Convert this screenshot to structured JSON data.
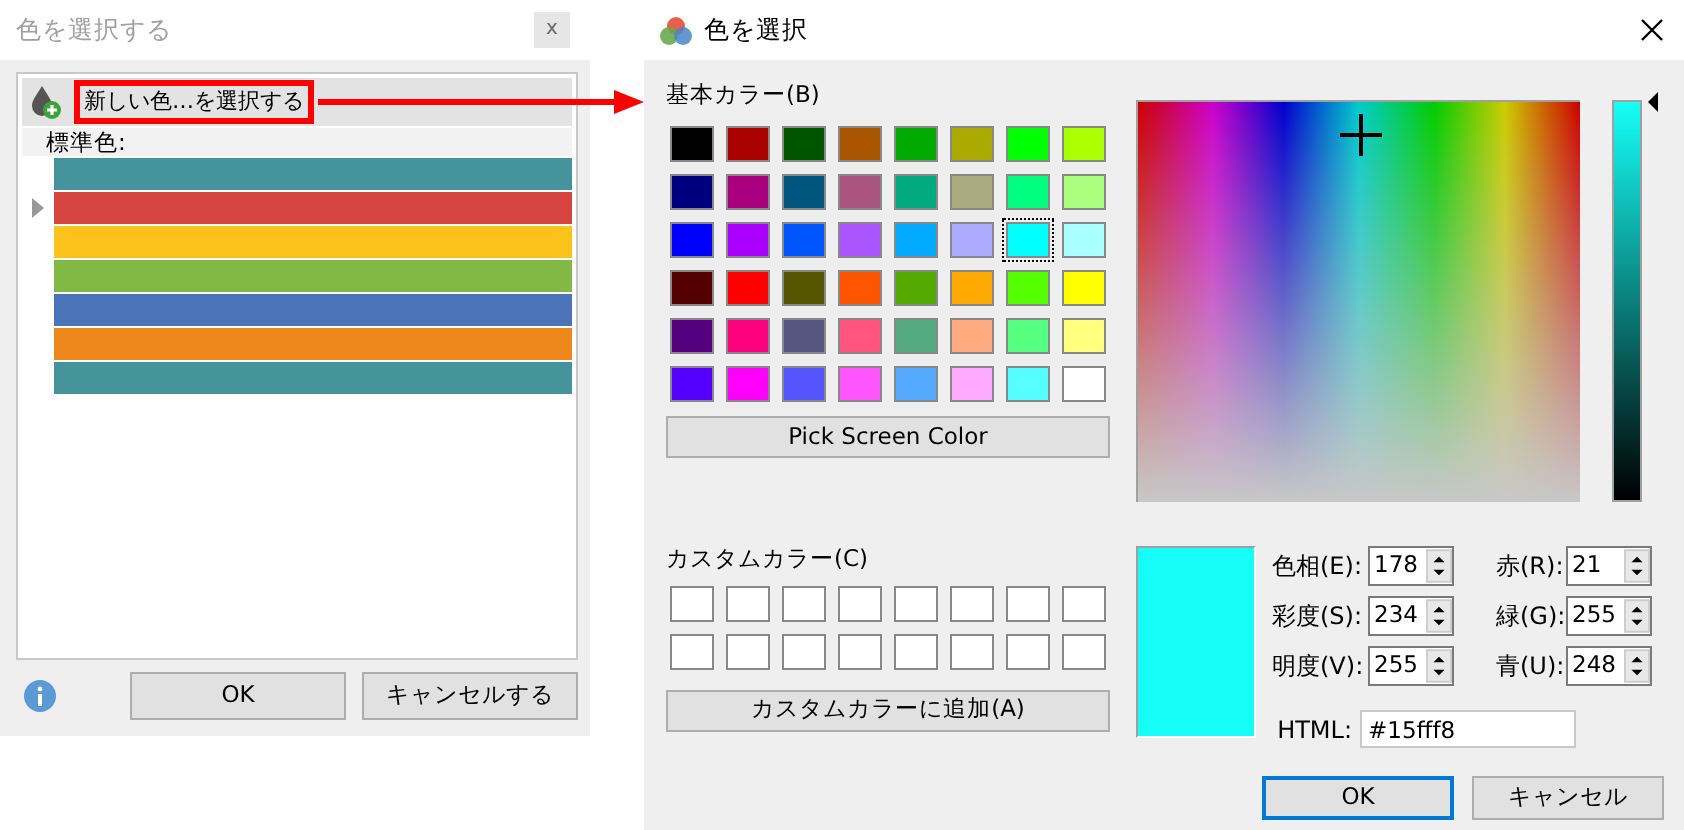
{
  "left_dialog": {
    "title": "色を選択する",
    "close": "x",
    "new_color_label": "新しい色…を選択する",
    "section_label": "標準色:",
    "standard_colors": [
      {
        "color": "#45939b",
        "selected": false
      },
      {
        "color": "#d5443f",
        "selected": true
      },
      {
        "color": "#fbc21c",
        "selected": false
      },
      {
        "color": "#82b844",
        "selected": false
      },
      {
        "color": "#4b74b8",
        "selected": false
      },
      {
        "color": "#ef881a",
        "selected": false
      },
      {
        "color": "#45939b",
        "selected": false
      }
    ],
    "buttons": [
      {
        "label": "OK"
      },
      {
        "label": "キャンセルする"
      }
    ]
  },
  "color_dialog": {
    "title": "色を選択",
    "basic_label": "基本カラー(B)",
    "basic_colors": [
      {
        "color": "#000000",
        "selected": false
      },
      {
        "color": "#aa0000",
        "selected": false
      },
      {
        "color": "#005500",
        "selected": false
      },
      {
        "color": "#aa5500",
        "selected": false
      },
      {
        "color": "#00aa00",
        "selected": false
      },
      {
        "color": "#aaaa00",
        "selected": false
      },
      {
        "color": "#00ff00",
        "selected": false
      },
      {
        "color": "#aaff00",
        "selected": false
      },
      {
        "color": "#00007f",
        "selected": false
      },
      {
        "color": "#aa007f",
        "selected": false
      },
      {
        "color": "#00557f",
        "selected": false
      },
      {
        "color": "#aa557f",
        "selected": false
      },
      {
        "color": "#00aa7f",
        "selected": false
      },
      {
        "color": "#aaaa7f",
        "selected": false
      },
      {
        "color": "#00ff7f",
        "selected": false
      },
      {
        "color": "#aaff7f",
        "selected": false
      },
      {
        "color": "#0000ff",
        "selected": false
      },
      {
        "color": "#aa00ff",
        "selected": false
      },
      {
        "color": "#0055ff",
        "selected": false
      },
      {
        "color": "#aa55ff",
        "selected": false
      },
      {
        "color": "#00aaff",
        "selected": false
      },
      {
        "color": "#aaaaff",
        "selected": false
      },
      {
        "color": "#00ffff",
        "selected": true
      },
      {
        "color": "#aaffff",
        "selected": false
      },
      {
        "color": "#550000",
        "selected": false
      },
      {
        "color": "#ff0000",
        "selected": false
      },
      {
        "color": "#555500",
        "selected": false
      },
      {
        "color": "#ff5500",
        "selected": false
      },
      {
        "color": "#55aa00",
        "selected": false
      },
      {
        "color": "#ffaa00",
        "selected": false
      },
      {
        "color": "#55ff00",
        "selected": false
      },
      {
        "color": "#ffff00",
        "selected": false
      },
      {
        "color": "#55007f",
        "selected": false
      },
      {
        "color": "#ff007f",
        "selected": false
      },
      {
        "color": "#55557f",
        "selected": false
      },
      {
        "color": "#ff557f",
        "selected": false
      },
      {
        "color": "#55aa7f",
        "selected": false
      },
      {
        "color": "#ffaa7f",
        "selected": false
      },
      {
        "color": "#55ff7f",
        "selected": false
      },
      {
        "color": "#ffff7f",
        "selected": false
      },
      {
        "color": "#5500ff",
        "selected": false
      },
      {
        "color": "#ff00ff",
        "selected": false
      },
      {
        "color": "#5555ff",
        "selected": false
      },
      {
        "color": "#ff55ff",
        "selected": false
      },
      {
        "color": "#55aaff",
        "selected": false
      },
      {
        "color": "#ffaaff",
        "selected": false
      },
      {
        "color": "#55ffff",
        "selected": false
      },
      {
        "color": "#ffffff",
        "selected": false
      }
    ],
    "pick_button": "Pick Screen Color",
    "custom_label": "カスタムカラー(C)",
    "custom_colors": [
      {
        "color": "#ffffff"
      },
      {
        "color": "#ffffff"
      },
      {
        "color": "#ffffff"
      },
      {
        "color": "#ffffff"
      },
      {
        "color": "#ffffff"
      },
      {
        "color": "#ffffff"
      },
      {
        "color": "#ffffff"
      },
      {
        "color": "#ffffff"
      },
      {
        "color": "#ffffff"
      },
      {
        "color": "#ffffff"
      },
      {
        "color": "#ffffff"
      },
      {
        "color": "#ffffff"
      },
      {
        "color": "#ffffff"
      },
      {
        "color": "#ffffff"
      },
      {
        "color": "#ffffff"
      },
      {
        "color": "#ffffff"
      }
    ],
    "add_button": "カスタムカラーに追加(A)",
    "hsv_fields": [
      {
        "label": "色相(E):",
        "value": "178"
      },
      {
        "label": "彩度(S):",
        "value": "234"
      },
      {
        "label": "明度(V):",
        "value": "255"
      }
    ],
    "rgb_fields": [
      {
        "label": "赤(R):",
        "value": "21"
      },
      {
        "label": "緑(G):",
        "value": "255"
      },
      {
        "label": "青(U):",
        "value": "248"
      }
    ],
    "html_field": {
      "label": "HTML:",
      "value": "#15fff8"
    },
    "value_slider": {
      "level": 1
    },
    "buttons": [
      {
        "label": "OK",
        "default": true
      },
      {
        "label": "キャンセル",
        "default": false
      }
    ]
  }
}
